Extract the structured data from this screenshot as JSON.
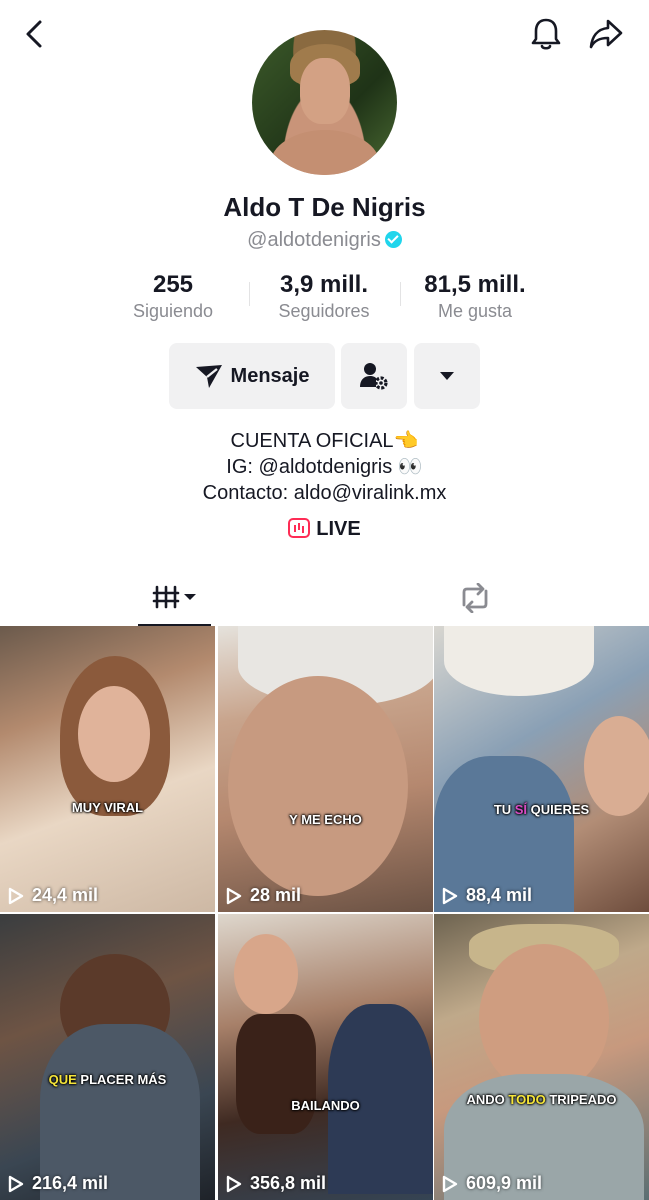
{
  "profile": {
    "name": "Aldo T De Nigris",
    "handle": "@aldotdenigris"
  },
  "stats": [
    {
      "value": "255",
      "label": "Siguiendo"
    },
    {
      "value": "3,9 mill.",
      "label": "Seguidores"
    },
    {
      "value": "81,5 mill.",
      "label": "Me gusta"
    }
  ],
  "actions": {
    "message_label": "Mensaje"
  },
  "bio": {
    "line1": "CUENTA OFICIAL👈",
    "line2": "IG: @aldotdenigris 👀",
    "line3": "Contacto: aldo@viralink.mx"
  },
  "live_label": "LIVE",
  "videos": [
    {
      "views": "24,4 mil",
      "caption": "MUY VIRAL"
    },
    {
      "views": "28 mil",
      "caption": "Y ME ECHO"
    },
    {
      "views": "88,4 mil",
      "caption_a": "TU ",
      "caption_b": "SÍ",
      "caption_c": " QUIERES"
    },
    {
      "views": "216,4 mil",
      "caption_a": "QUE",
      "caption_b": " PLACER MÁS"
    },
    {
      "views": "356,8 mil",
      "caption": "BAILANDO"
    },
    {
      "views": "609,9 mil",
      "caption_a": "ANDO ",
      "caption_b": "TODO",
      "caption_c": " TRIPEADO"
    }
  ],
  "colors": {
    "accent": "#fe2c55",
    "verified": "#20d5ec",
    "secondary_text": "#8a8b91",
    "button_bg": "#f1f1f2"
  }
}
